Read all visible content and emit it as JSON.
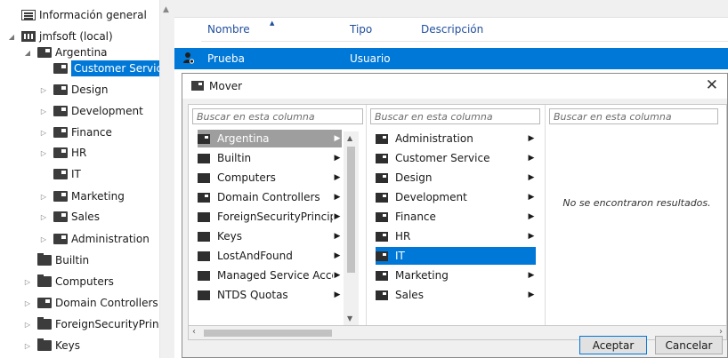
{
  "tree": {
    "items": [
      {
        "label": "Información general",
        "icon": "info-icon",
        "expander": "",
        "indent": 0
      },
      {
        "label": "jmfsoft (local)",
        "icon": "domain-icon",
        "expander": "◢",
        "indent": 0
      },
      {
        "label": "Argentina",
        "icon": "ou-icon",
        "expander": "◢",
        "indent": 1
      },
      {
        "label": "Customer Service",
        "icon": "ou-icon",
        "expander": "",
        "indent": 2,
        "selected": true
      },
      {
        "label": "Design",
        "icon": "ou-icon",
        "expander": "▷",
        "indent": 2
      },
      {
        "label": "Development",
        "icon": "ou-icon",
        "expander": "▷",
        "indent": 2
      },
      {
        "label": "Finance",
        "icon": "ou-icon",
        "expander": "▷",
        "indent": 2
      },
      {
        "label": "HR",
        "icon": "ou-icon",
        "expander": "▷",
        "indent": 2
      },
      {
        "label": "IT",
        "icon": "ou-icon",
        "expander": "",
        "indent": 2
      },
      {
        "label": "Marketing",
        "icon": "ou-icon",
        "expander": "▷",
        "indent": 2
      },
      {
        "label": "Sales",
        "icon": "ou-icon",
        "expander": "▷",
        "indent": 2
      },
      {
        "label": "Administration",
        "icon": "ou-icon",
        "expander": "▷",
        "indent": 2
      },
      {
        "label": "Builtin",
        "icon": "folder-icon",
        "expander": "",
        "indent": 1
      },
      {
        "label": "Computers",
        "icon": "folder-icon",
        "expander": "▷",
        "indent": 1
      },
      {
        "label": "Domain Controllers",
        "icon": "ou-icon",
        "expander": "▷",
        "indent": 1
      },
      {
        "label": "ForeignSecurityPrincip",
        "icon": "folder-icon",
        "expander": "▷",
        "indent": 1
      },
      {
        "label": "Keys",
        "icon": "folder-icon",
        "expander": "▷",
        "indent": 1
      }
    ]
  },
  "list": {
    "columns": [
      "Nombre",
      "Tipo",
      "Descripción"
    ],
    "rows": [
      {
        "name": "Prueba",
        "type": "Usuario",
        "description": ""
      }
    ]
  },
  "dialog": {
    "title": "Mover",
    "search_placeholder": "Buscar en esta columna",
    "column1": [
      {
        "label": "Argentina",
        "icon": "ou-icon",
        "arrow": "▶",
        "state": "gray"
      },
      {
        "label": "Builtin",
        "icon": "folder-icon",
        "arrow": "▶"
      },
      {
        "label": "Computers",
        "icon": "folder-icon",
        "arrow": "▶"
      },
      {
        "label": "Domain Controllers",
        "icon": "ou-icon",
        "arrow": "▶"
      },
      {
        "label": "ForeignSecurityPrincipa",
        "icon": "folder-icon",
        "arrow": "▶"
      },
      {
        "label": "Keys",
        "icon": "folder-icon",
        "arrow": "▶"
      },
      {
        "label": "LostAndFound",
        "icon": "folder-icon",
        "arrow": "▶"
      },
      {
        "label": "Managed Service Accou",
        "icon": "folder-icon",
        "arrow": "▶"
      },
      {
        "label": "NTDS Quotas",
        "icon": "folder-icon",
        "arrow": "▶"
      }
    ],
    "column2": [
      {
        "label": "Administration",
        "icon": "ou-icon",
        "arrow": "▶"
      },
      {
        "label": "Customer Service",
        "icon": "ou-icon",
        "arrow": "▶"
      },
      {
        "label": "Design",
        "icon": "ou-icon",
        "arrow": "▶"
      },
      {
        "label": "Development",
        "icon": "ou-icon",
        "arrow": "▶"
      },
      {
        "label": "Finance",
        "icon": "ou-icon",
        "arrow": "▶"
      },
      {
        "label": "HR",
        "icon": "ou-icon",
        "arrow": "▶"
      },
      {
        "label": "IT",
        "icon": "ou-icon",
        "arrow": "",
        "state": "blue"
      },
      {
        "label": "Marketing",
        "icon": "ou-icon",
        "arrow": "▶"
      },
      {
        "label": "Sales",
        "icon": "ou-icon",
        "arrow": "▶"
      }
    ],
    "empty_message": "No se encontraron resultados.",
    "ok_label": "Aceptar",
    "cancel_label": "Cancelar"
  },
  "colors": {
    "selection_blue": "#0078d7",
    "selection_gray": "#9e9e9e",
    "header_text": "#1f4e9c"
  }
}
